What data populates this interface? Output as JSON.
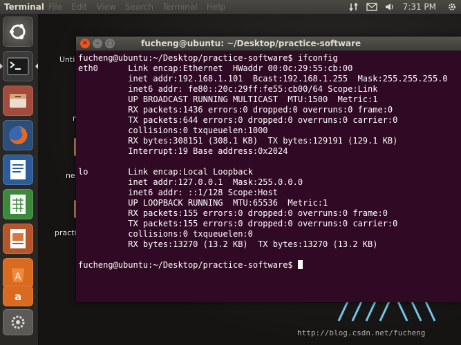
{
  "top_panel": {
    "app_name": "Terminal",
    "menu": [
      "File",
      "Edit",
      "View",
      "Search",
      "Terminal",
      "Help"
    ],
    "clock": "7:31 PM"
  },
  "desktop": {
    "labels": [
      "Unti",
      "n",
      "ne",
      "practi"
    ]
  },
  "window": {
    "title": "fucheng@ubuntu: ~/Desktop/practice-software"
  },
  "terminal": {
    "lines": [
      "fucheng@ubuntu:~/Desktop/practice-software$ ifconfig",
      "eth0      Link encap:Ethernet  HWaddr 00:0c:29:55:cb:00",
      "          inet addr:192.168.1.101  Bcast:192.168.1.255  Mask:255.255.255.0",
      "          inet6 addr: fe80::20c:29ff:fe55:cb00/64 Scope:Link",
      "          UP BROADCAST RUNNING MULTICAST  MTU:1500  Metric:1",
      "          RX packets:1436 errors:0 dropped:0 overruns:0 frame:0",
      "          TX packets:644 errors:0 dropped:0 overruns:0 carrier:0",
      "          collisions:0 txqueuelen:1000",
      "          RX bytes:308151 (308.1 KB)  TX bytes:129191 (129.1 KB)",
      "          Interrupt:19 Base address:0x2024",
      "",
      "lo        Link encap:Local Loopback",
      "          inet addr:127.0.0.1  Mask:255.0.0.0",
      "          inet6 addr: ::1/128 Scope:Host",
      "          UP LOOPBACK RUNNING  MTU:65536  Metric:1",
      "          RX packets:155 errors:0 dropped:0 overruns:0 frame:0",
      "          TX packets:155 errors:0 dropped:0 overruns:0 carrier:0",
      "          collisions:0 txqueuelen:0",
      "          RX bytes:13270 (13.2 KB)  TX bytes:13270 (13.2 KB)",
      "",
      "fucheng@ubuntu:~/Desktop/practice-software$ "
    ]
  },
  "watermark": "http://blog.csdn.net/fucheng",
  "launcher": {
    "items": [
      "ubuntu-dash-icon",
      "terminal-icon",
      "files-icon",
      "firefox-icon",
      "writer-icon",
      "calc-icon",
      "impress-icon",
      "software-center-icon",
      "amazon-icon",
      "settings-icon"
    ]
  },
  "colors": {
    "terminal_bg": "#300a24",
    "panel_bg": "#3b3a36",
    "accent": "#e95420"
  }
}
